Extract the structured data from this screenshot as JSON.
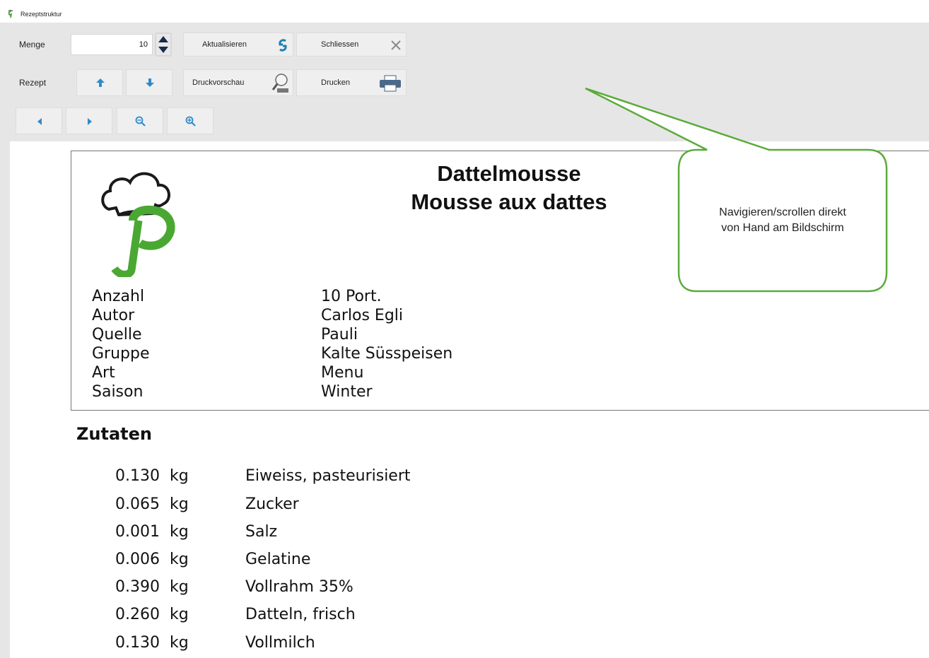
{
  "window": {
    "title": "Rezeptstruktur"
  },
  "toolbar": {
    "menge_label": "Menge",
    "menge_value": "10",
    "aktualisieren_label": "Aktualisieren",
    "schliessen_label": "Schliessen",
    "rezept_label": "Rezept",
    "druckvorschau_label": "Druckvorschau",
    "drucken_label": "Drucken"
  },
  "recipe": {
    "title_de": "Dattelmousse",
    "title_fr": "Mousse aux dattes",
    "meta": [
      {
        "key": "Anzahl",
        "value": "10 Port."
      },
      {
        "key": "Autor",
        "value": "Carlos Egli"
      },
      {
        "key": "Quelle",
        "value": "Pauli"
      },
      {
        "key": "Gruppe",
        "value": "Kalte Süsspeisen"
      },
      {
        "key": "Art",
        "value": "Menu"
      },
      {
        "key": "Saison",
        "value": "Winter"
      }
    ],
    "ingredients_heading": "Zutaten",
    "ingredients": [
      {
        "qty": "0.130",
        "unit": "kg",
        "name": "Eiweiss, pasteurisiert"
      },
      {
        "qty": "0.065",
        "unit": "kg",
        "name": "Zucker"
      },
      {
        "qty": "0.001",
        "unit": "kg",
        "name": "Salz"
      },
      {
        "qty": "0.006",
        "unit": "kg",
        "name": "Gelatine"
      },
      {
        "qty": "0.390",
        "unit": "kg",
        "name": "Vollrahm 35%"
      },
      {
        "qty": "0.260",
        "unit": "kg",
        "name": "Datteln, frisch"
      },
      {
        "qty": "0.130",
        "unit": "kg",
        "name": "Vollmilch"
      }
    ]
  },
  "callout": {
    "line1": "Navigieren/scrollen direkt",
    "line2": "von Hand am Bildschirm"
  },
  "colors": {
    "accent_green": "#4aa832",
    "refresh_blue": "#1f7fb0",
    "toolbar_bg": "#e6e6e6"
  }
}
